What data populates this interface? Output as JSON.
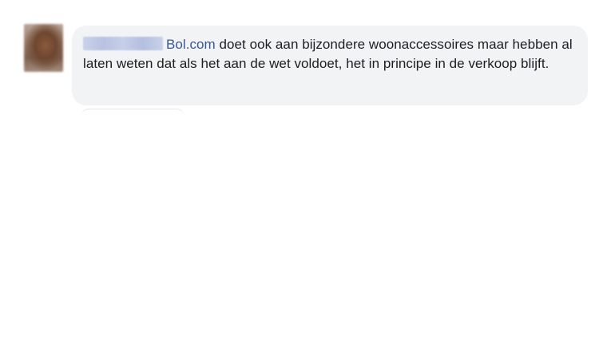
{
  "comment": {
    "author_name": "",
    "link_text": "Bol.com",
    "text_rest": " doet ook aan bijzondere woonaccessoires maar hebben al laten weten dat als het aan de wet voldoet, het in principe in de verkoop blijft."
  }
}
